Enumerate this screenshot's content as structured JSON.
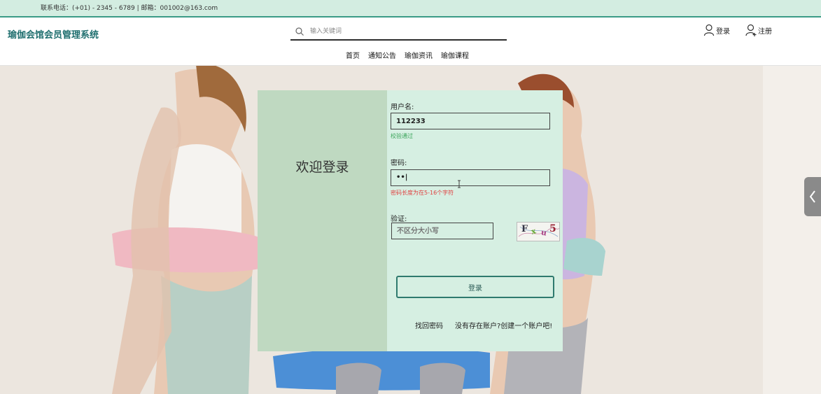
{
  "topbar": {
    "contact": "联系电话：(+01) - 2345 - 6789 | 邮箱：001002@163.com"
  },
  "header": {
    "logo": "瑜伽会馆会员管理系统",
    "search_placeholder": "输入关键词",
    "login_label": "登录",
    "register_label": "注册",
    "nav": [
      "首页",
      "通知公告",
      "瑜伽资讯",
      "瑜伽课程"
    ]
  },
  "login": {
    "welcome": "欢迎登录",
    "username_label": "用户名:",
    "username_value": "112233",
    "username_msg": "校验通过",
    "password_label": "密码:",
    "password_value": "••|",
    "password_msg": "密码长度为在5-16个字符",
    "captcha_label": "验证:",
    "captcha_placeholder": "不区分大小写",
    "captcha_text": [
      "F",
      "x",
      "u",
      "5"
    ],
    "submit_label": "登录",
    "forgot_label": "找回密码",
    "create_label": "没有存在账户?创建一个账户吧!"
  },
  "colors": {
    "accent": "#3b9b86",
    "card_left": "#bfd9c1",
    "card_right": "#d6efe2",
    "ok": "#3aa55a",
    "error": "#e04040"
  }
}
